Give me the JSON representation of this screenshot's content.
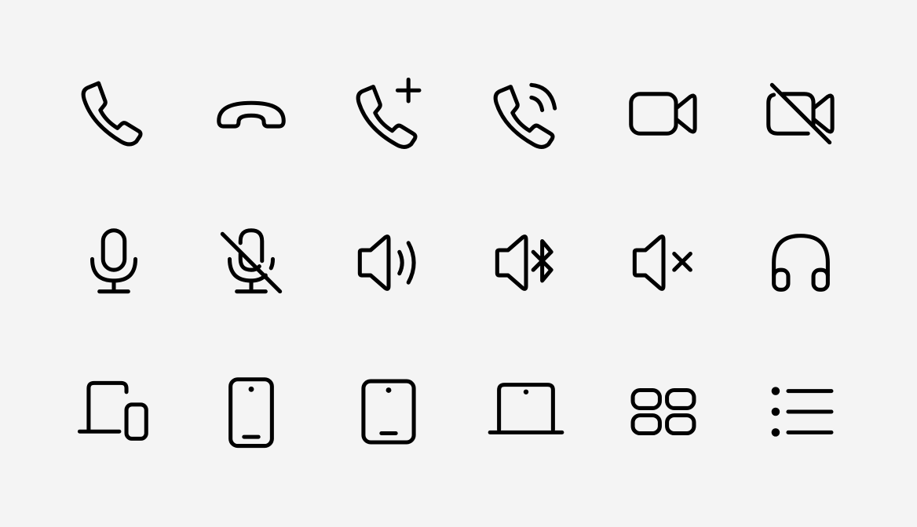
{
  "icons": [
    [
      "phone-icon",
      "phone-hangup-icon",
      "phone-add-icon",
      "phone-ringing-icon",
      "video-icon",
      "video-off-icon"
    ],
    [
      "microphone-icon",
      "microphone-off-icon",
      "speaker-volume-icon",
      "speaker-bluetooth-icon",
      "speaker-mute-icon",
      "headphones-icon"
    ],
    [
      "devices-icon",
      "smartphone-icon",
      "tablet-icon",
      "laptop-icon",
      "grid-view-icon",
      "list-view-icon"
    ]
  ],
  "colors": {
    "background": "#f4f4f4",
    "icon_stroke": "#000000"
  }
}
